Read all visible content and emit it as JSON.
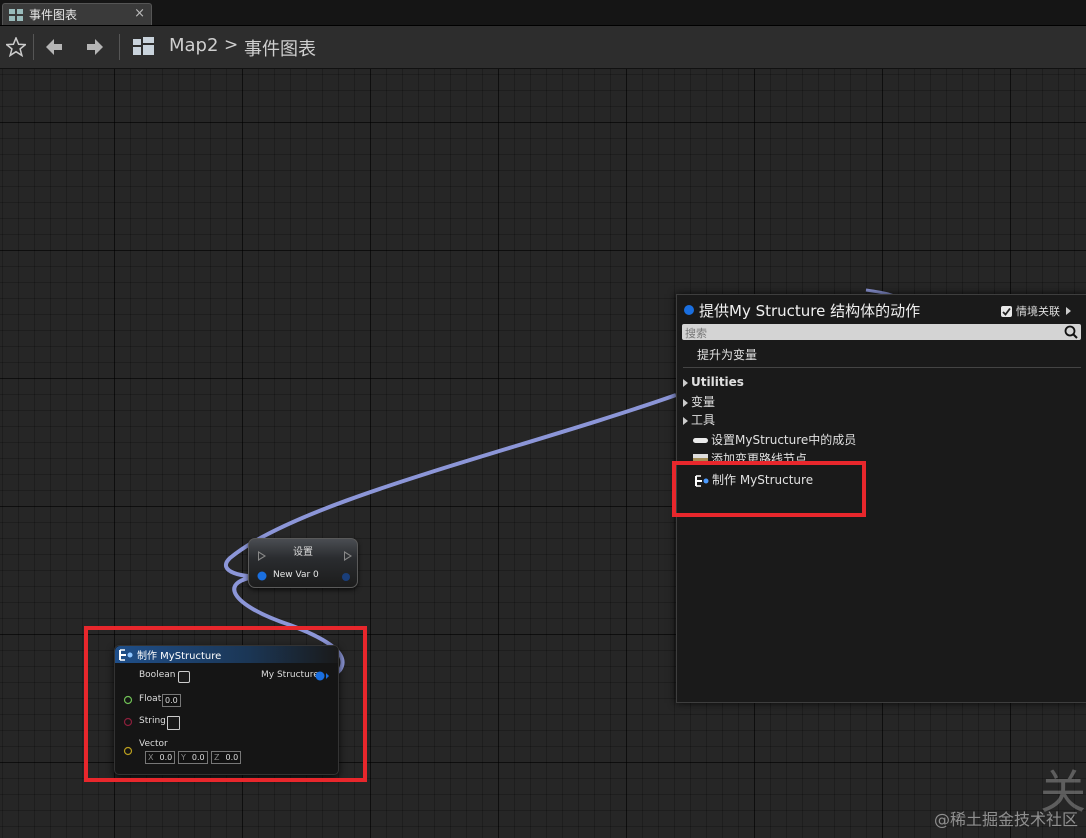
{
  "tab": {
    "label": "事件图表",
    "close": "×"
  },
  "breadcrumb": {
    "root": "Map2",
    "separator": ">",
    "current": "事件图表"
  },
  "set_node": {
    "title": "设置",
    "pin_label": "New Var 0"
  },
  "make_node": {
    "title": "制作 MyStructure",
    "output_label": "My Structure",
    "boolean_label": "Boolean",
    "float_label": "Float",
    "float_value": "0.0",
    "string_label": "String",
    "vector_label": "Vector",
    "vector": {
      "x_label": "X",
      "x": "0.0",
      "y_label": "Y",
      "y": "0.0",
      "z_label": "Z",
      "z": "0.0"
    }
  },
  "menu": {
    "title": "提供My Structure 结构体的动作",
    "context_label": "情境关联",
    "context_checked": true,
    "search_placeholder": "搜索",
    "items": [
      {
        "label": "提升为变量"
      },
      {
        "label": "Utilities"
      },
      {
        "label": "变量"
      },
      {
        "label": "工具"
      },
      {
        "label": "设置MyStructure中的成员"
      },
      {
        "label": "添加变更路线节点"
      },
      {
        "label": "制作 MyStructure"
      }
    ]
  },
  "watermark": "@稀土掘金技术社区",
  "corner_glyph": "关",
  "colors": {
    "highlight": "#e8272c",
    "wire": "#8c96d8",
    "struct_pin": "#1a6fe0"
  }
}
